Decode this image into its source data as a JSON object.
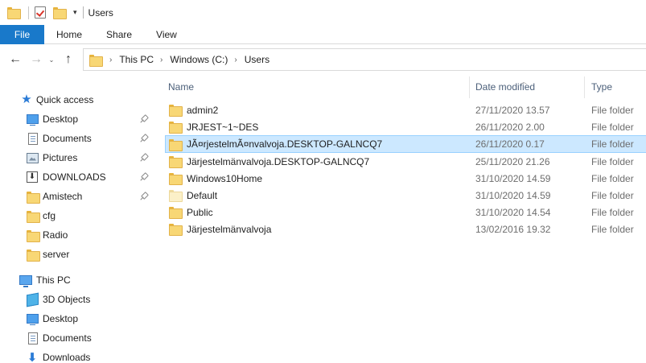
{
  "window": {
    "title": "Users",
    "qat_dropdown": "▾"
  },
  "ribbon": {
    "tabs": [
      {
        "label": "File"
      },
      {
        "label": "Home"
      },
      {
        "label": "Share"
      },
      {
        "label": "View"
      }
    ]
  },
  "nav": {
    "back_icon": "←",
    "forward_icon": "→",
    "recent_icon": "⌄",
    "up_icon": "↑",
    "breadcrumb": [
      "This PC",
      "Windows (C:)",
      "Users"
    ],
    "crumb_separator": "›"
  },
  "navpane": {
    "items": [
      {
        "label": "Quick access",
        "icon": "star-icon",
        "pinned": false
      },
      {
        "label": "Desktop",
        "icon": "desktop-icon",
        "pinned": true
      },
      {
        "label": "Documents",
        "icon": "document-icon",
        "pinned": true
      },
      {
        "label": "Pictures",
        "icon": "pictures-icon",
        "pinned": true
      },
      {
        "label": "DOWNLOADS",
        "icon": "download-box-icon",
        "pinned": true
      },
      {
        "label": "Amistech",
        "icon": "folder-icon",
        "pinned": true
      },
      {
        "label": "cfg",
        "icon": "folder-icon",
        "pinned": false
      },
      {
        "label": "Radio",
        "icon": "folder-icon",
        "pinned": false
      },
      {
        "label": "server",
        "icon": "folder-icon",
        "pinned": false
      },
      {
        "label": "This PC",
        "icon": "computer-icon",
        "pinned": false
      },
      {
        "label": "3D Objects",
        "icon": "3d-objects-icon",
        "pinned": false
      },
      {
        "label": "Desktop",
        "icon": "desktop-icon",
        "pinned": false
      },
      {
        "label": "Documents",
        "icon": "document-icon",
        "pinned": false
      },
      {
        "label": "Downloads",
        "icon": "download-arrow-icon",
        "pinned": false
      }
    ]
  },
  "files": {
    "columns": {
      "name": "Name",
      "date": "Date modified",
      "type": "Type"
    },
    "rows": [
      {
        "name": "admin2",
        "date": "27/11/2020 13.57",
        "type": "File folder",
        "selected": false,
        "pale": false
      },
      {
        "name": "JRJEST~1~DES",
        "date": "26/11/2020 2.00",
        "type": "File folder",
        "selected": false,
        "pale": false
      },
      {
        "name": "JÃ¤rjestelmÃ¤nvalvoja.DESKTOP-GALNCQ7",
        "date": "26/11/2020 0.17",
        "type": "File folder",
        "selected": true,
        "pale": false
      },
      {
        "name": "Järjestelmänvalvoja.DESKTOP-GALNCQ7",
        "date": "25/11/2020 21.26",
        "type": "File folder",
        "selected": false,
        "pale": false
      },
      {
        "name": "Windows10Home",
        "date": "31/10/2020 14.59",
        "type": "File folder",
        "selected": false,
        "pale": false
      },
      {
        "name": "Default",
        "date": "31/10/2020 14.59",
        "type": "File folder",
        "selected": false,
        "pale": true
      },
      {
        "name": "Public",
        "date": "31/10/2020 14.54",
        "type": "File folder",
        "selected": false,
        "pale": false
      },
      {
        "name": "Järjestelmänvalvoja",
        "date": "13/02/2016 19.32",
        "type": "File folder",
        "selected": false,
        "pale": false
      }
    ]
  },
  "colors": {
    "file_tab": "#1979ca",
    "selection_bg": "#cce8ff",
    "selection_border": "#99d1ff",
    "folder": "#f8d775"
  }
}
